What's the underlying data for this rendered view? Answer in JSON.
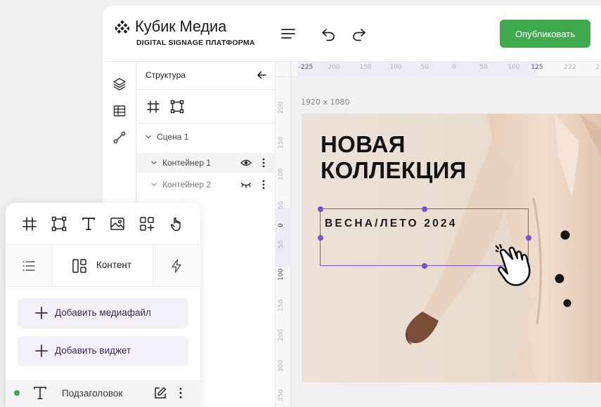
{
  "app": {
    "title": "Кубик Медиа",
    "subtitle": "DIGITAL SIGNAGE ПЛАТФОРМА",
    "publish_label": "Опубликовать"
  },
  "colors": {
    "accent_green": "#3daa4e",
    "selection_purple": "#7a52d1",
    "add_button_bg": "#f4f0f9"
  },
  "icons": {
    "logo": "diamond-dots-logo-icon",
    "menu": "hamburger-menu-icon",
    "undo": "undo-arrow-icon",
    "redo": "redo-arrow-icon",
    "layers": "layers-icon",
    "table": "table-grid-icon",
    "connect": "node-connection-icon"
  },
  "structure": {
    "title": "Структура",
    "tree": [
      {
        "label": "Сцена 1",
        "expanded": true,
        "visible": true
      },
      {
        "label": "Контейнер 1",
        "expanded": true,
        "visible": true,
        "selected": true
      },
      {
        "label": "Контейнер 2",
        "expanded": true,
        "visible": false
      }
    ]
  },
  "canvas": {
    "size_label": "1920 x 1080",
    "ruler_top": [
      "-225",
      "200",
      "150",
      "100",
      "50",
      "0",
      "50",
      "100",
      "125",
      "222",
      "2"
    ],
    "ruler_top_selected": [
      "-225",
      "125"
    ],
    "ruler_left": [
      "200",
      "150",
      "100",
      "50",
      "0",
      "50",
      "100",
      "150",
      "200",
      "300",
      "350"
    ],
    "ruler_left_selected": [
      "0",
      "100"
    ],
    "artboard": {
      "headline_line1": "НОВАЯ",
      "headline_line2": "КОЛЛЕКЦИЯ",
      "subheadline": "ВЕСНА/ЛЕТО 2024"
    }
  },
  "panel": {
    "tabs": [
      {
        "label": "",
        "icon": "list-icon"
      },
      {
        "label": "Контент",
        "icon": "content-blocks-icon",
        "active": true
      },
      {
        "label": "",
        "icon": "lightning-icon"
      }
    ],
    "buttons": {
      "add_media": "Добавить медиафайл",
      "add_widget": "Добавить виджет"
    },
    "layer": {
      "label": "Подзаголовок",
      "status": "active"
    }
  }
}
